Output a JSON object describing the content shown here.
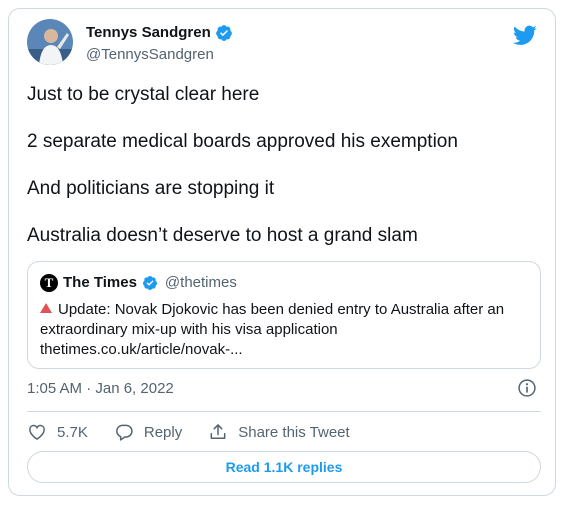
{
  "tweet": {
    "author_name": "Tennys Sandgren",
    "author_handle": "@TennysSandgren",
    "verified": true,
    "lines": [
      "Just to be crystal clear here",
      "2 separate medical boards approved his exemption",
      "And politicians are stopping it",
      "Australia doesn’t deserve to host a grand slam"
    ],
    "timestamp": "1:05 AM · Jan 6, 2022"
  },
  "quote": {
    "logo_letter": "T",
    "name": "The Times",
    "handle": "@thetimes",
    "verified": true,
    "text": "Update: Novak Djokovic has been denied entry to Australia after an extraordinary mix-up with his visa application",
    "link": "thetimes.co.uk/article/novak-..."
  },
  "actions": {
    "like_count": "5.7K",
    "reply_label": "Reply",
    "share_label": "Share this Tweet"
  },
  "read_replies_label": "Read 1.1K replies",
  "icons": {
    "brand": "twitter-bird-icon",
    "verified": "verified-badge-icon",
    "info": "info-icon",
    "like": "heart-icon",
    "reply": "reply-bubble-icon",
    "share": "share-icon"
  },
  "colors": {
    "accent": "#1d9bf0",
    "text": "#0f1419",
    "muted": "#536471",
    "border": "#cfd9de",
    "alert_triangle": "#e1515a"
  }
}
